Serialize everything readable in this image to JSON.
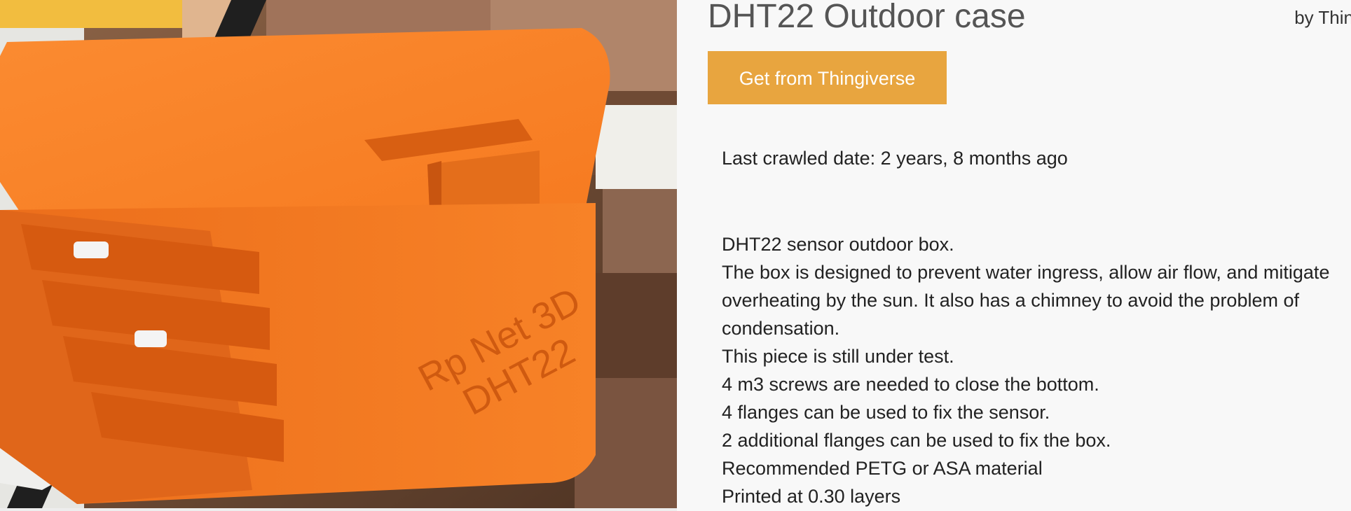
{
  "thing": {
    "title": "DHT22 Outdoor case",
    "author": "by Thin",
    "get_button_label": "Get from Thingiverse",
    "last_crawled": "Last crawled date: 2 years, 8 months ago"
  },
  "photo": {
    "embossed_text": [
      "Rp Net 3D",
      "DHT22"
    ]
  },
  "description": {
    "lines": [
      "DHT22 sensor outdoor box.",
      "The box is designed to prevent water ingress, allow air flow, and mitigate",
      "overheating by the sun. It also has a chimney to avoid the problem of",
      "condensation.",
      "This piece is still under test.",
      "4 m3 screws are needed to close the bottom.",
      "4 flanges can be used to fix the sensor.",
      "2 additional flanges can be used to fix the box.",
      "Recommended PETG or ASA material",
      "Printed at 0.30 layers"
    ]
  },
  "colors": {
    "button_bg": "#e8a53f",
    "page_bg": "#f8f8f8",
    "title_text": "#555555",
    "case_orange": "#f47a22"
  }
}
